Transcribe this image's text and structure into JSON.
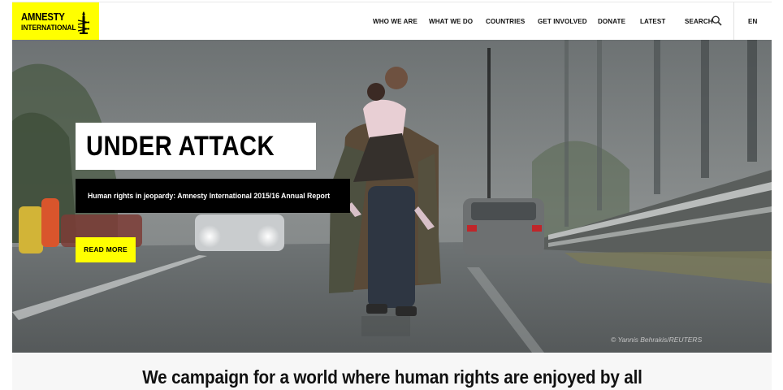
{
  "logo": {
    "line1": "AMNESTY",
    "line2": "INTERNATIONAL",
    "icon": "candle-barbed-wire-icon",
    "color": "#FFFF00"
  },
  "nav": {
    "items": [
      {
        "label": "WHO WE ARE"
      },
      {
        "label": "WHAT WE DO"
      },
      {
        "label": "COUNTRIES"
      },
      {
        "label": "GET INVOLVED"
      },
      {
        "label": "DONATE"
      },
      {
        "label": "LATEST"
      }
    ],
    "search_label": "SEARCH",
    "search_icon": "search-icon",
    "language": "EN"
  },
  "hero": {
    "title": "UNDER ATTACK",
    "subtitle": "Human rights in jeopardy: Amnesty International 2015/16 Annual Report",
    "button_label": "READ MORE",
    "photo_credit": "© Yannis Behrakis/REUTERS"
  },
  "tagline": "We campaign for a world where human rights are enjoyed by all",
  "colors": {
    "brand_yellow": "#FFFF00",
    "text": "#111111",
    "black": "#000000"
  }
}
